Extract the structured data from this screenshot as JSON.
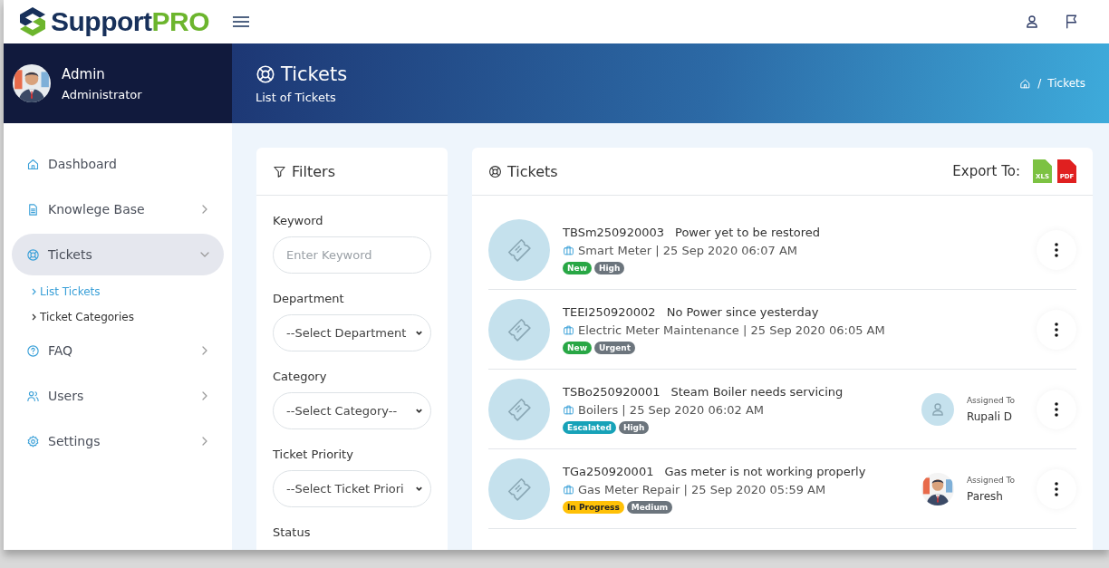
{
  "brand": {
    "name": "Support",
    "accent": "PRO"
  },
  "profile": {
    "name": "Admin",
    "role": "Administrator"
  },
  "page": {
    "title": "Tickets",
    "subtitle": "List of Tickets",
    "breadcrumb": {
      "separator": "/",
      "label": "Tickets"
    }
  },
  "sidebar": {
    "items": [
      {
        "label": "Dashboard",
        "kind": "link",
        "selected": false
      },
      {
        "label": "Knowlege Base",
        "kind": "menu",
        "selected": false,
        "expanded": false
      },
      {
        "label": "Tickets",
        "kind": "menu",
        "selected": true,
        "expanded": true,
        "children": [
          {
            "label": "List Tickets",
            "selected": true
          },
          {
            "label": "Ticket Categories",
            "selected": false
          }
        ]
      },
      {
        "label": "FAQ",
        "kind": "menu",
        "selected": false,
        "expanded": false
      },
      {
        "label": "Users",
        "kind": "menu",
        "selected": false,
        "expanded": false
      },
      {
        "label": "Settings",
        "kind": "menu",
        "selected": false,
        "expanded": false
      }
    ]
  },
  "filters": {
    "title": "Filters",
    "fields": [
      {
        "label": "Keyword",
        "kind": "input",
        "placeholder": "Enter Keyword"
      },
      {
        "label": "Department",
        "kind": "select",
        "value": "--Select Department"
      },
      {
        "label": "Category",
        "kind": "select",
        "value": "--Select Category--"
      },
      {
        "label": "Ticket Priority",
        "kind": "select",
        "value": "--Select Ticket Priori"
      },
      {
        "label": "Status",
        "kind": "label"
      }
    ]
  },
  "tickets": {
    "title": "Tickets",
    "export_label": "Export To:",
    "exports": [
      {
        "label": "XLS",
        "color": "#7cc242"
      },
      {
        "label": "PDF",
        "color": "#e02020"
      }
    ],
    "rows": [
      {
        "id": "TBSm250920003",
        "subject": "Power yet to be restored",
        "meta": "Smart Meter | 25 Sep 2020 06:07 AM",
        "badges": [
          {
            "label": "New",
            "color": "#28a745"
          },
          {
            "label": "High",
            "color": "#6c757d"
          }
        ]
      },
      {
        "id": "TEEI250920002",
        "subject": "No Power since yesterday",
        "meta": "Electric Meter Maintenance | 25 Sep 2020 06:05 AM",
        "badges": [
          {
            "label": "New",
            "color": "#28a745"
          },
          {
            "label": "Urgent",
            "color": "#6c757d"
          }
        ]
      },
      {
        "id": "TSBo250920001",
        "subject": "Steam Boiler needs servicing",
        "meta": "Boilers | 25 Sep 2020 06:02 AM",
        "badges": [
          {
            "label": "Escalated",
            "color": "#17a2b8"
          },
          {
            "label": "High",
            "color": "#6c757d"
          }
        ],
        "assignee": {
          "label": "Assigned To",
          "name": "Rupali D",
          "kind": "default"
        }
      },
      {
        "id": "TGa250920001",
        "subject": "Gas meter is not working properly",
        "meta": "Gas Meter Repair | 25 Sep 2020 05:59 AM",
        "badges": [
          {
            "label": "In Progress",
            "color": "#ffc107"
          },
          {
            "label": "Medium",
            "color": "#6c757d"
          }
        ],
        "assignee": {
          "label": "Assigned To",
          "name": "Paresh"
        }
      }
    ]
  }
}
